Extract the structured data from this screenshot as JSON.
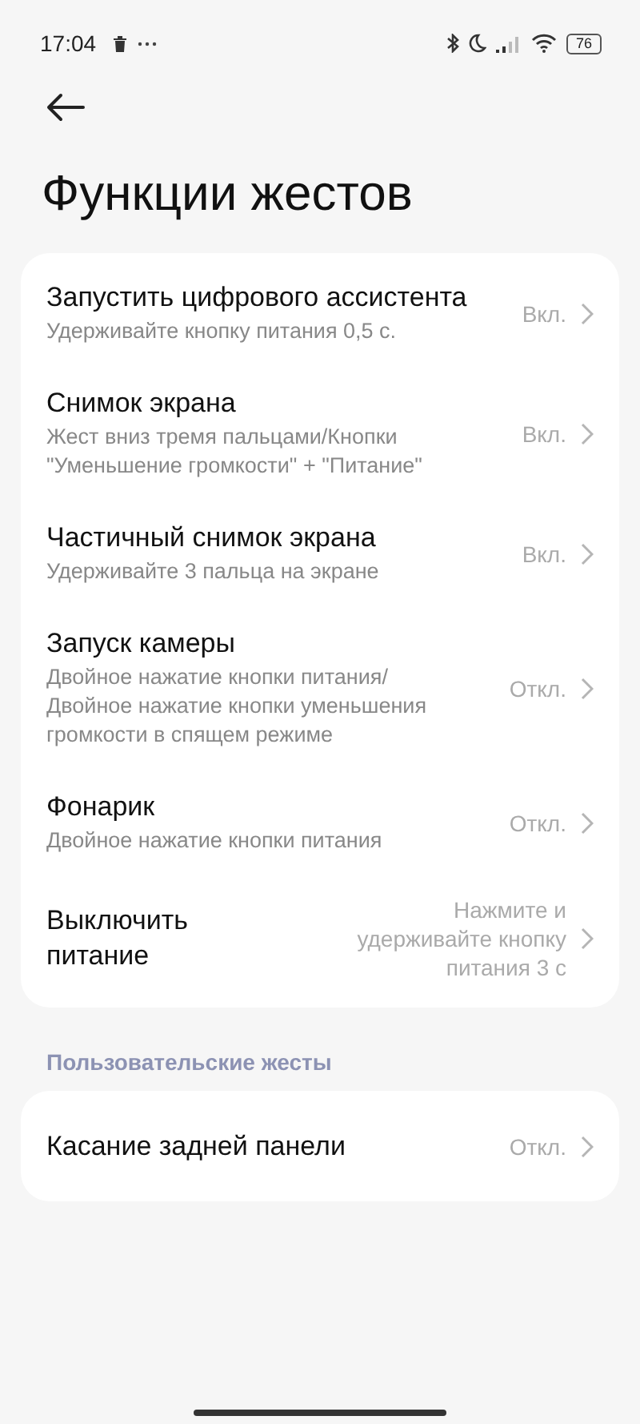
{
  "status_bar": {
    "time": "17:04",
    "battery": "76"
  },
  "title": "Функции жестов",
  "groups": [
    {
      "items": [
        {
          "title": "Запустить цифрового ассистента",
          "subtitle": "Удерживайте кнопку питания 0,5 с.",
          "value": "Вкл."
        },
        {
          "title": "Снимок экрана",
          "subtitle": "Жест вниз тремя пальцами/Кнопки \"Уменьшение громкости\" + \"Питание\"",
          "value": "Вкл."
        },
        {
          "title": "Частичный снимок экрана",
          "subtitle": "Удерживайте 3 пальца на экране",
          "value": "Вкл."
        },
        {
          "title": "Запуск камеры",
          "subtitle": "Двойное нажатие кнопки питания/ Двойное нажатие кнопки уменьшения громкости в спящем режиме",
          "value": "Откл."
        },
        {
          "title": "Фонарик",
          "subtitle": "Двойное нажатие кнопки питания",
          "value": "Откл."
        },
        {
          "title": "Выключить питание",
          "value": "Нажмите и удерживайте кнопку питания 3 с"
        }
      ]
    },
    {
      "header": "Пользовательские жесты",
      "items": [
        {
          "title": "Касание задней панели",
          "value": "Откл."
        }
      ]
    }
  ]
}
